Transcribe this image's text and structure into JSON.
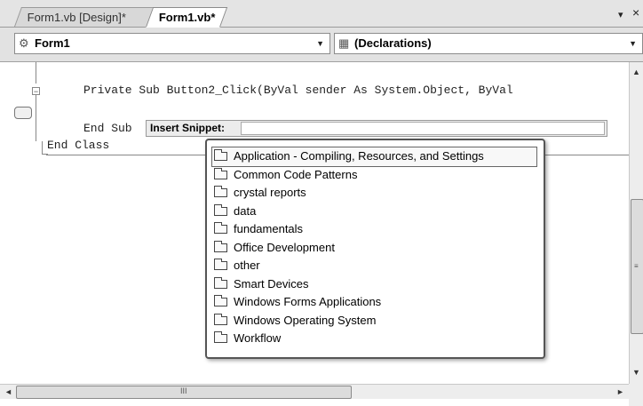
{
  "tabs": [
    {
      "label": "Form1.vb [Design]*",
      "active": false
    },
    {
      "label": "Form1.vb*",
      "active": true
    }
  ],
  "tab_controls": {
    "dropdown_icon": "chevron-down-icon",
    "close_icon": "close-icon",
    "dropdown": "▾",
    "close": "×"
  },
  "navbar": {
    "class_combo": {
      "icon": "class-icon",
      "value": "Form1"
    },
    "method_combo": {
      "icon": "declarations-icon",
      "value": "(Declarations)"
    }
  },
  "code": {
    "line1": "Private Sub Button2_Click(ByVal sender As System.Object, ByVal",
    "line2": "End Sub",
    "line3": "End Class"
  },
  "snippet": {
    "label": "Insert Snippet:",
    "input_value": "",
    "items": [
      {
        "label": "Application - Compiling, Resources, and Settings",
        "selected": true
      },
      {
        "label": "Common Code Patterns"
      },
      {
        "label": "crystal reports"
      },
      {
        "label": "data"
      },
      {
        "label": "fundamentals"
      },
      {
        "label": "Office Development"
      },
      {
        "label": "other"
      },
      {
        "label": "Smart Devices"
      },
      {
        "label": "Windows Forms Applications"
      },
      {
        "label": "Windows Operating System"
      },
      {
        "label": "Workflow"
      }
    ]
  },
  "scrollbars": {
    "up": "▲",
    "down": "▼",
    "left": "◄",
    "right": "►",
    "grip_h": "III",
    "grip_v": "≡"
  }
}
